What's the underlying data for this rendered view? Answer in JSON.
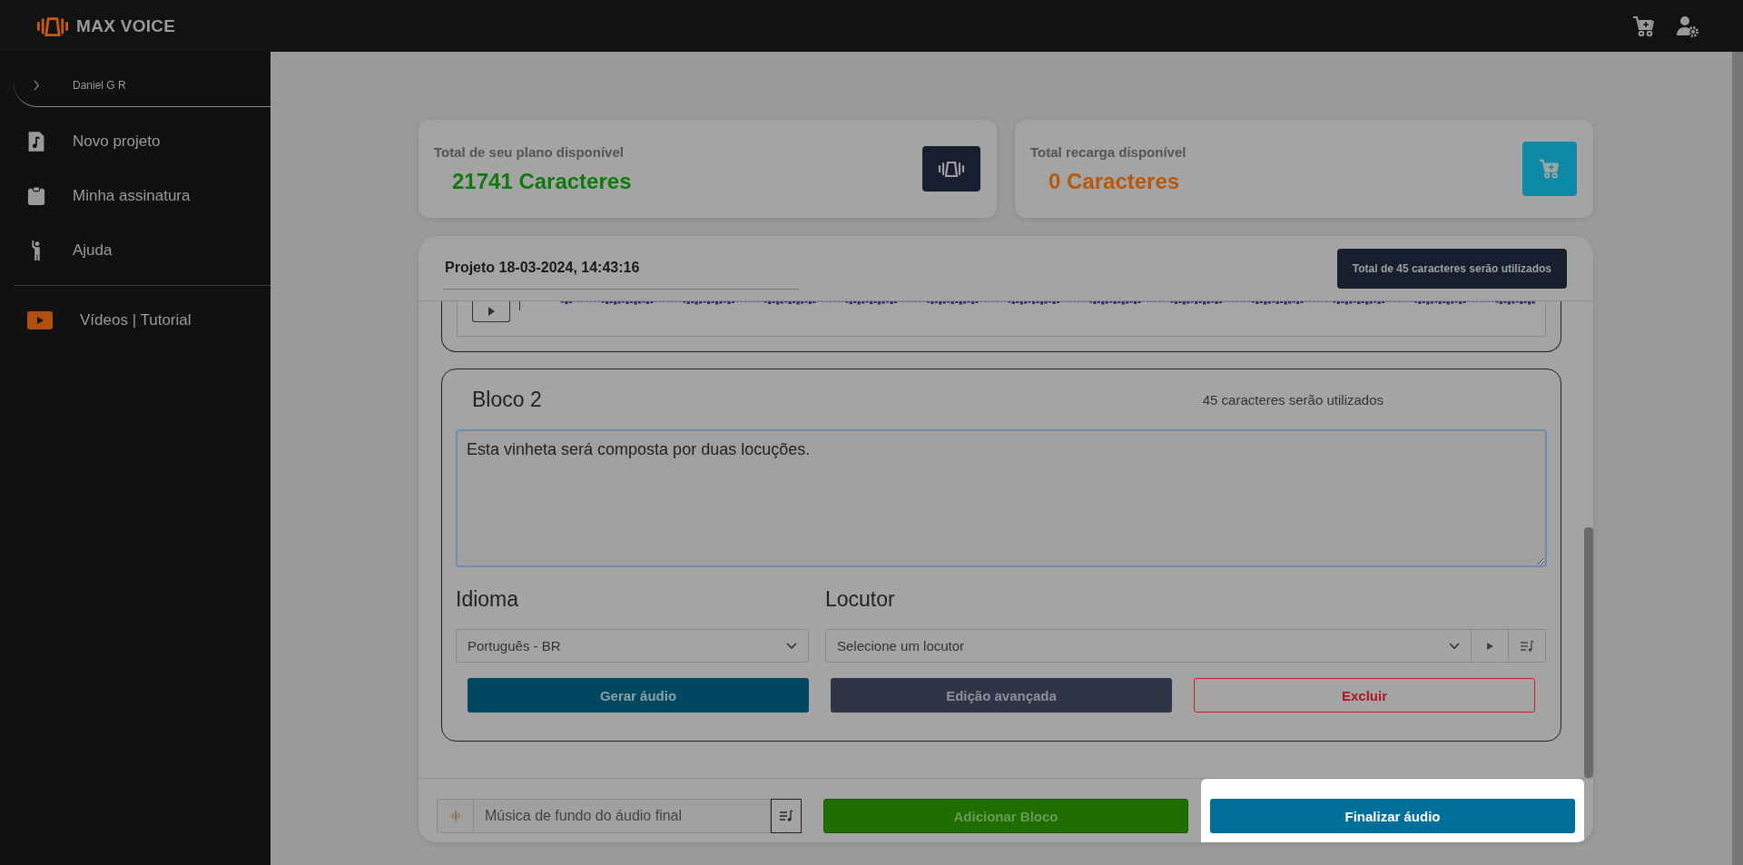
{
  "app": {
    "name": "MAX VOICE"
  },
  "user": {
    "name": "Daniel G R"
  },
  "sidebar": {
    "items": [
      {
        "label": "Novo projeto",
        "kind": "file-music"
      },
      {
        "label": "Minha assinatura",
        "kind": "clipboard"
      },
      {
        "label": "Ajuda",
        "kind": "person"
      }
    ],
    "extra_items": [
      {
        "label": "Vídeos | Tutorial",
        "kind": "video"
      }
    ]
  },
  "balances": [
    {
      "label": "Total de seu plano disponível",
      "value": "21741 Caracteres",
      "color": "#107a0c",
      "kind": "plan"
    },
    {
      "label": "Total recarga disponível",
      "value": "0 Caracteres",
      "color": "#b8580c",
      "kind": "recharge"
    }
  ],
  "project": {
    "title": "Projeto 18-03-2024, 14:43:16",
    "usage_badge": "Total de 45 caracteres serão utilizados",
    "blocks": [
      {
        "title": "Bloco 2",
        "usage": "45 caracteres serão utilizados",
        "text": "Esta vinheta será composta por duas locuções.",
        "language_label": "Idioma",
        "language": "Português - BR",
        "speaker_label": "Locutor",
        "speaker_placeholder": "Selecione um locutor",
        "buttons": [
          {
            "label": "Gerar áudio",
            "kind": "generate"
          },
          {
            "label": "Edição avançada",
            "kind": "advanced"
          },
          {
            "label": "Excluir",
            "kind": "delete"
          }
        ]
      }
    ],
    "footer": {
      "music_placeholder": "Música de fundo do áudio final",
      "buttons": [
        {
          "label": "Adicionar Bloco",
          "kind": "add",
          "highlighted": false
        },
        {
          "label": "Finalizar áudio",
          "kind": "finish",
          "highlighted": true
        }
      ]
    }
  }
}
